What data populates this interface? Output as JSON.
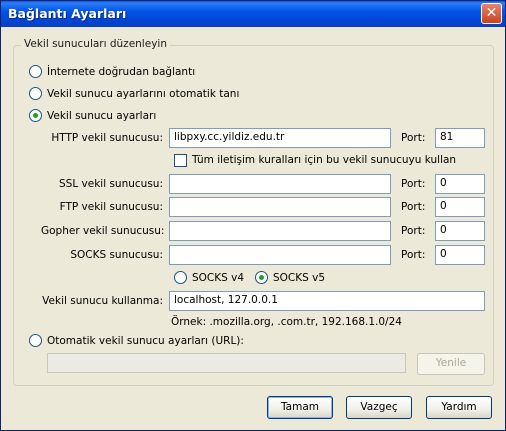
{
  "window": {
    "title": "Bağlantı Ayarları",
    "close_glyph": "✕"
  },
  "group": {
    "legend": "Vekil sunucuları düzenleyin"
  },
  "options": {
    "direct": "İnternete doğrudan bağlantı",
    "auto_detect": "Vekil sunucu ayarlarını otomatik tanı",
    "manual": "Vekil sunucu ayarları",
    "auto_url": "Otomatik vekil sunucu ayarları (URL):"
  },
  "proxies": {
    "http": {
      "label": "HTTP vekil sunucusu:",
      "value": "libpxy.cc.yildiz.edu.tr",
      "port_label": "Port:",
      "port": "81"
    },
    "share_all": "Tüm iletişim kuralları için bu vekil sunucuyu kullan",
    "ssl": {
      "label": "SSL vekil sunucusu:",
      "value": "",
      "port_label": "Port:",
      "port": "0"
    },
    "ftp": {
      "label": "FTP vekil sunucusu:",
      "value": "",
      "port_label": "Port:",
      "port": "0"
    },
    "gopher": {
      "label": "Gopher vekil sunucusu:",
      "value": "",
      "port_label": "Port:",
      "port": "0"
    },
    "socks": {
      "label": "SOCKS sunucusu:",
      "value": "",
      "port_label": "Port:",
      "port": "0"
    },
    "socks_v4": "SOCKS v4",
    "socks_v5": "SOCKS v5",
    "no_proxy": {
      "label": "Vekil sunucu kullanma:",
      "value": "localhost, 127.0.0.1"
    },
    "example": "Örnek: .mozilla.org, .com.tr, 192.168.1.0/24"
  },
  "auto": {
    "url_value": "",
    "reload": "Yenile"
  },
  "buttons": {
    "ok": "Tamam",
    "cancel": "Vazgeç",
    "help": "Yardım"
  }
}
